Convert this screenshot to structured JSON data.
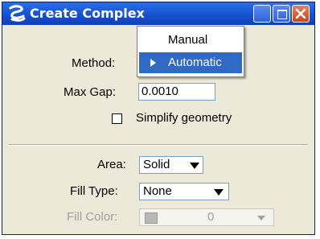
{
  "window": {
    "title": "Create Complex"
  },
  "icons": {
    "app": "app-logo-icon",
    "close": "close-icon"
  },
  "form": {
    "method_label": "Method:",
    "max_gap_label": "Max Gap:",
    "max_gap_value": "0.0010",
    "simplify_label": "Simplify geometry",
    "simplify_checked": false,
    "area_label": "Area:",
    "area_value": "Solid",
    "fill_type_label": "Fill Type:",
    "fill_type_value": "None",
    "fill_color_label": "Fill Color:",
    "fill_color_value": "0"
  },
  "method_menu": {
    "items": [
      {
        "label": "Manual",
        "selected": false
      },
      {
        "label": "Automatic",
        "selected": true
      }
    ]
  },
  "colors": {
    "title_bar": "#1652d0",
    "selection": "#316ac5",
    "close_button": "#c8451f"
  }
}
